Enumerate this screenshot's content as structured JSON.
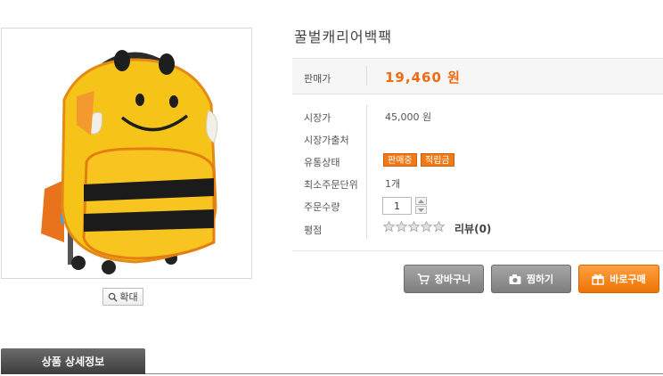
{
  "product": {
    "title": "꿀벌캐리어백팩",
    "image_alt": "bee-rolling-backpack",
    "zoom_label": "확대"
  },
  "price": {
    "label": "판매가",
    "value": "19,460 원"
  },
  "details": [
    {
      "label": "시장가",
      "value": "45,000 원"
    },
    {
      "label": "시장가출처",
      "value": ""
    },
    {
      "label": "유통상태",
      "badges": [
        "판매중",
        "적립금"
      ]
    },
    {
      "label": "최소주문단위",
      "value": "1개"
    },
    {
      "label": "주문수량",
      "qty": "1"
    },
    {
      "label": "평점",
      "rating": 0,
      "review": "리뷰(0)"
    }
  ],
  "buttons": {
    "cart": "장바구니",
    "wish": "찜하기",
    "buy": "바로구매"
  },
  "tabs": {
    "detail": "상품 상세정보"
  },
  "colors": {
    "accent": "#f26a0e",
    "badge": "#f07a17",
    "gray_button": "#8e8e8e"
  }
}
